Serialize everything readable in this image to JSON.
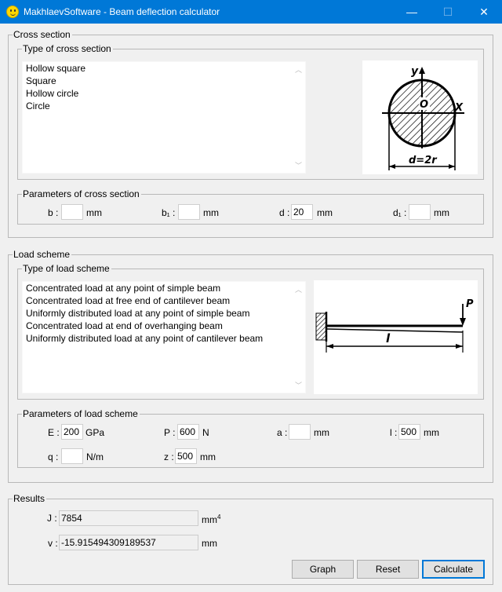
{
  "window": {
    "title": "MakhlaevSoftware - Beam deflection calculator",
    "minimize": "—",
    "maximize": "☐",
    "close": "✕"
  },
  "cross_section": {
    "legend": "Cross section",
    "type_legend": "Type of cross section",
    "types": [
      "Hollow square",
      "Square",
      "Hollow circle",
      "Circle"
    ],
    "params_legend": "Parameters of cross section",
    "b_label": "b :",
    "b_value": "",
    "b_unit": "mm",
    "b1_label": "b₁ :",
    "b1_value": "",
    "b1_unit": "mm",
    "d_label": "d :",
    "d_value": "20",
    "d_unit": "mm",
    "d1_label": "d₁ :",
    "d1_value": "",
    "d1_unit": "mm",
    "figure": {
      "y_label": "y",
      "x_label": "X",
      "o_label": "O",
      "dim_label": "d=2r"
    }
  },
  "load_scheme": {
    "legend": "Load scheme",
    "type_legend": "Type of load scheme",
    "types": [
      "Concentrated load at any point of simple beam",
      "Concentrated load at free end of cantilever beam",
      "Uniformly distributed load at any point of simple beam",
      "Concentrated load at end of overhanging beam",
      "Uniformly distributed load at any point of cantilever beam"
    ],
    "params_legend": "Parameters of load scheme",
    "E_label": "E :",
    "E_value": "200",
    "E_unit": "GPa",
    "P_label": "P :",
    "P_value": "600",
    "P_unit": "N",
    "a_label": "a :",
    "a_value": "",
    "a_unit": "mm",
    "l_label": "l :",
    "l_value": "500",
    "l_unit": "mm",
    "q_label": "q :",
    "q_value": "",
    "q_unit": "N/m",
    "z_label": "z :",
    "z_value": "500",
    "z_unit": "mm",
    "figure": {
      "p_label": "P",
      "l_label": "l"
    }
  },
  "results": {
    "legend": "Results",
    "J_label": "J :",
    "J_value": "7854",
    "J_unit": "mm",
    "J_unit_exp": "4",
    "v_label": "v :",
    "v_value": "-15.915494309189537",
    "v_unit": "mm"
  },
  "buttons": {
    "graph": "Graph",
    "reset": "Reset",
    "calculate": "Calculate"
  }
}
